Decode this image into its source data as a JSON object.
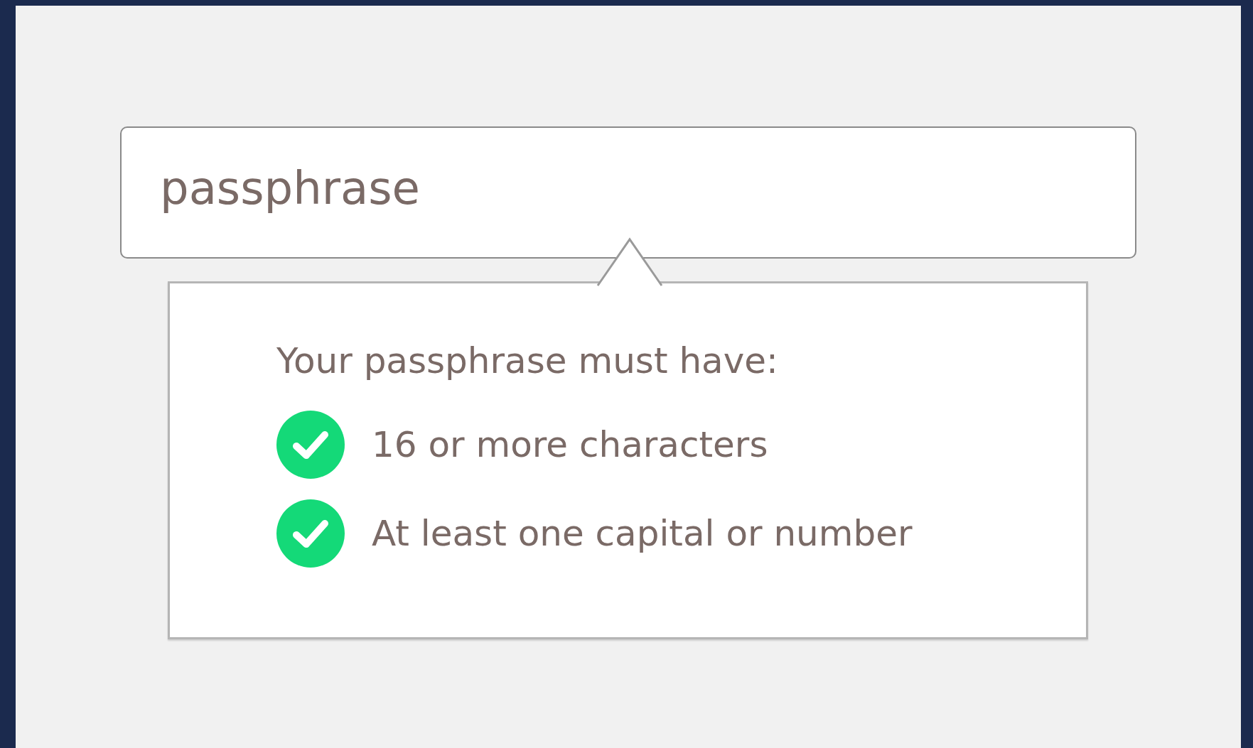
{
  "field": {
    "value": "passphrase"
  },
  "requirements": {
    "heading": "Your passphrase must have:",
    "items": [
      {
        "label": "16 or more characters",
        "met": true
      },
      {
        "label": "At least one capital or number",
        "met": true
      }
    ]
  }
}
